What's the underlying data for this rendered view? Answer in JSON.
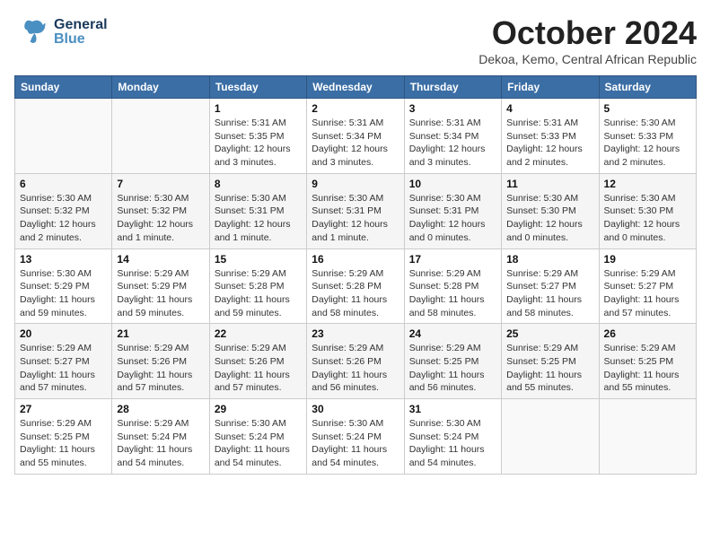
{
  "header": {
    "logo_general": "General",
    "logo_blue": "Blue",
    "month_title": "October 2024",
    "subtitle": "Dekoa, Kemo, Central African Republic"
  },
  "days_of_week": [
    "Sunday",
    "Monday",
    "Tuesday",
    "Wednesday",
    "Thursday",
    "Friday",
    "Saturday"
  ],
  "weeks": [
    [
      {
        "day": "",
        "info": ""
      },
      {
        "day": "",
        "info": ""
      },
      {
        "day": "1",
        "info": "Sunrise: 5:31 AM\nSunset: 5:35 PM\nDaylight: 12 hours and 3 minutes."
      },
      {
        "day": "2",
        "info": "Sunrise: 5:31 AM\nSunset: 5:34 PM\nDaylight: 12 hours and 3 minutes."
      },
      {
        "day": "3",
        "info": "Sunrise: 5:31 AM\nSunset: 5:34 PM\nDaylight: 12 hours and 3 minutes."
      },
      {
        "day": "4",
        "info": "Sunrise: 5:31 AM\nSunset: 5:33 PM\nDaylight: 12 hours and 2 minutes."
      },
      {
        "day": "5",
        "info": "Sunrise: 5:30 AM\nSunset: 5:33 PM\nDaylight: 12 hours and 2 minutes."
      }
    ],
    [
      {
        "day": "6",
        "info": "Sunrise: 5:30 AM\nSunset: 5:32 PM\nDaylight: 12 hours and 2 minutes."
      },
      {
        "day": "7",
        "info": "Sunrise: 5:30 AM\nSunset: 5:32 PM\nDaylight: 12 hours and 1 minute."
      },
      {
        "day": "8",
        "info": "Sunrise: 5:30 AM\nSunset: 5:31 PM\nDaylight: 12 hours and 1 minute."
      },
      {
        "day": "9",
        "info": "Sunrise: 5:30 AM\nSunset: 5:31 PM\nDaylight: 12 hours and 1 minute."
      },
      {
        "day": "10",
        "info": "Sunrise: 5:30 AM\nSunset: 5:31 PM\nDaylight: 12 hours and 0 minutes."
      },
      {
        "day": "11",
        "info": "Sunrise: 5:30 AM\nSunset: 5:30 PM\nDaylight: 12 hours and 0 minutes."
      },
      {
        "day": "12",
        "info": "Sunrise: 5:30 AM\nSunset: 5:30 PM\nDaylight: 12 hours and 0 minutes."
      }
    ],
    [
      {
        "day": "13",
        "info": "Sunrise: 5:30 AM\nSunset: 5:29 PM\nDaylight: 11 hours and 59 minutes."
      },
      {
        "day": "14",
        "info": "Sunrise: 5:29 AM\nSunset: 5:29 PM\nDaylight: 11 hours and 59 minutes."
      },
      {
        "day": "15",
        "info": "Sunrise: 5:29 AM\nSunset: 5:28 PM\nDaylight: 11 hours and 59 minutes."
      },
      {
        "day": "16",
        "info": "Sunrise: 5:29 AM\nSunset: 5:28 PM\nDaylight: 11 hours and 58 minutes."
      },
      {
        "day": "17",
        "info": "Sunrise: 5:29 AM\nSunset: 5:28 PM\nDaylight: 11 hours and 58 minutes."
      },
      {
        "day": "18",
        "info": "Sunrise: 5:29 AM\nSunset: 5:27 PM\nDaylight: 11 hours and 58 minutes."
      },
      {
        "day": "19",
        "info": "Sunrise: 5:29 AM\nSunset: 5:27 PM\nDaylight: 11 hours and 57 minutes."
      }
    ],
    [
      {
        "day": "20",
        "info": "Sunrise: 5:29 AM\nSunset: 5:27 PM\nDaylight: 11 hours and 57 minutes."
      },
      {
        "day": "21",
        "info": "Sunrise: 5:29 AM\nSunset: 5:26 PM\nDaylight: 11 hours and 57 minutes."
      },
      {
        "day": "22",
        "info": "Sunrise: 5:29 AM\nSunset: 5:26 PM\nDaylight: 11 hours and 57 minutes."
      },
      {
        "day": "23",
        "info": "Sunrise: 5:29 AM\nSunset: 5:26 PM\nDaylight: 11 hours and 56 minutes."
      },
      {
        "day": "24",
        "info": "Sunrise: 5:29 AM\nSunset: 5:25 PM\nDaylight: 11 hours and 56 minutes."
      },
      {
        "day": "25",
        "info": "Sunrise: 5:29 AM\nSunset: 5:25 PM\nDaylight: 11 hours and 55 minutes."
      },
      {
        "day": "26",
        "info": "Sunrise: 5:29 AM\nSunset: 5:25 PM\nDaylight: 11 hours and 55 minutes."
      }
    ],
    [
      {
        "day": "27",
        "info": "Sunrise: 5:29 AM\nSunset: 5:25 PM\nDaylight: 11 hours and 55 minutes."
      },
      {
        "day": "28",
        "info": "Sunrise: 5:29 AM\nSunset: 5:24 PM\nDaylight: 11 hours and 54 minutes."
      },
      {
        "day": "29",
        "info": "Sunrise: 5:30 AM\nSunset: 5:24 PM\nDaylight: 11 hours and 54 minutes."
      },
      {
        "day": "30",
        "info": "Sunrise: 5:30 AM\nSunset: 5:24 PM\nDaylight: 11 hours and 54 minutes."
      },
      {
        "day": "31",
        "info": "Sunrise: 5:30 AM\nSunset: 5:24 PM\nDaylight: 11 hours and 54 minutes."
      },
      {
        "day": "",
        "info": ""
      },
      {
        "day": "",
        "info": ""
      }
    ]
  ]
}
